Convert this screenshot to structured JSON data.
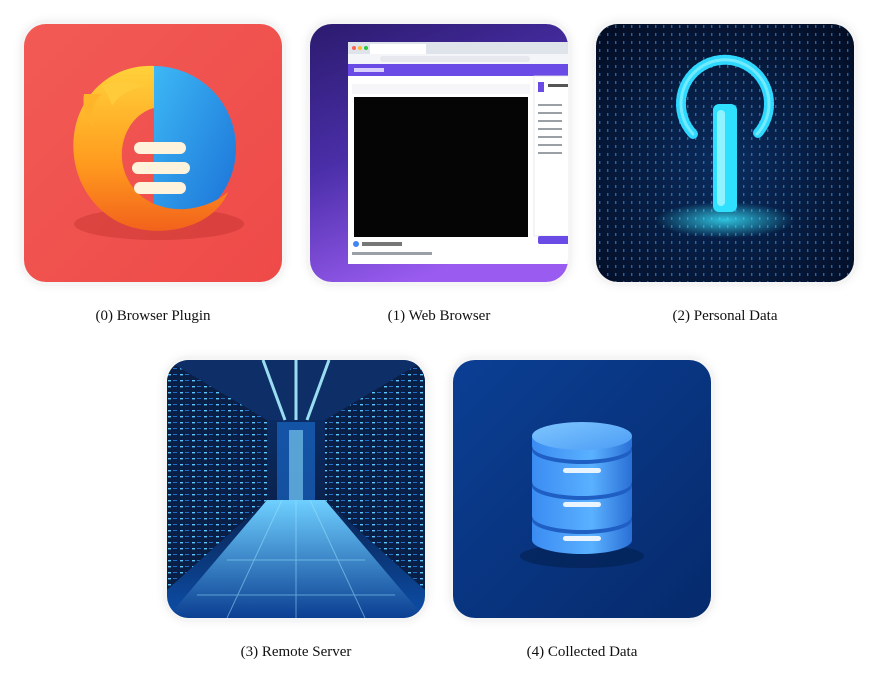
{
  "items": [
    {
      "caption": "(0) Browser Plugin",
      "icon": "firefox-plugin-icon"
    },
    {
      "caption": "(1) Web Browser",
      "icon": "web-browser-window-icon"
    },
    {
      "caption": "(2) Personal Data",
      "icon": "power-data-icon"
    },
    {
      "caption": "(3) Remote Server",
      "icon": "server-room-icon"
    },
    {
      "caption": "(4) Collected Data",
      "icon": "database-icon"
    }
  ],
  "colors": {
    "plugin_bg": "#f0544f",
    "browser_bg": "#6a3fd8",
    "personal_bg": "#04122e",
    "server_bg": "#0a2a5e",
    "database_bg": "#0a3a8a"
  }
}
